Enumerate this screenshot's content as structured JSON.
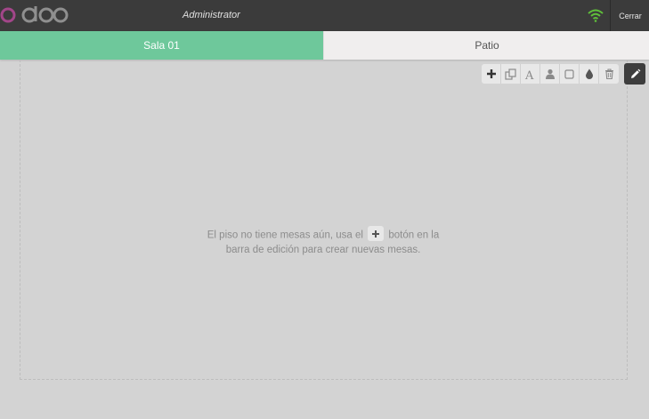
{
  "header": {
    "logo_text": "odoo",
    "user_name": "Administrator",
    "close_label": "Cerrar",
    "status_color": "#6ec89b"
  },
  "tabs": [
    {
      "label": "Sala 01",
      "active": true
    },
    {
      "label": "Patio",
      "active": false
    }
  ],
  "toolbar": {
    "tools": [
      "add-icon",
      "duplicate-icon",
      "rename-icon",
      "seats-icon",
      "shape-icon",
      "color-icon",
      "trash-icon"
    ],
    "edit_icon": "pencil-icon"
  },
  "floor": {
    "empty_text_before": "El piso no tiene mesas aún, usa el",
    "empty_text_after": "botón en la barra de edición para crear nuevas mesas."
  },
  "colors": {
    "accent": "#6ec89b",
    "topbar": "#3b3b3b",
    "background": "#d3d3d3"
  }
}
